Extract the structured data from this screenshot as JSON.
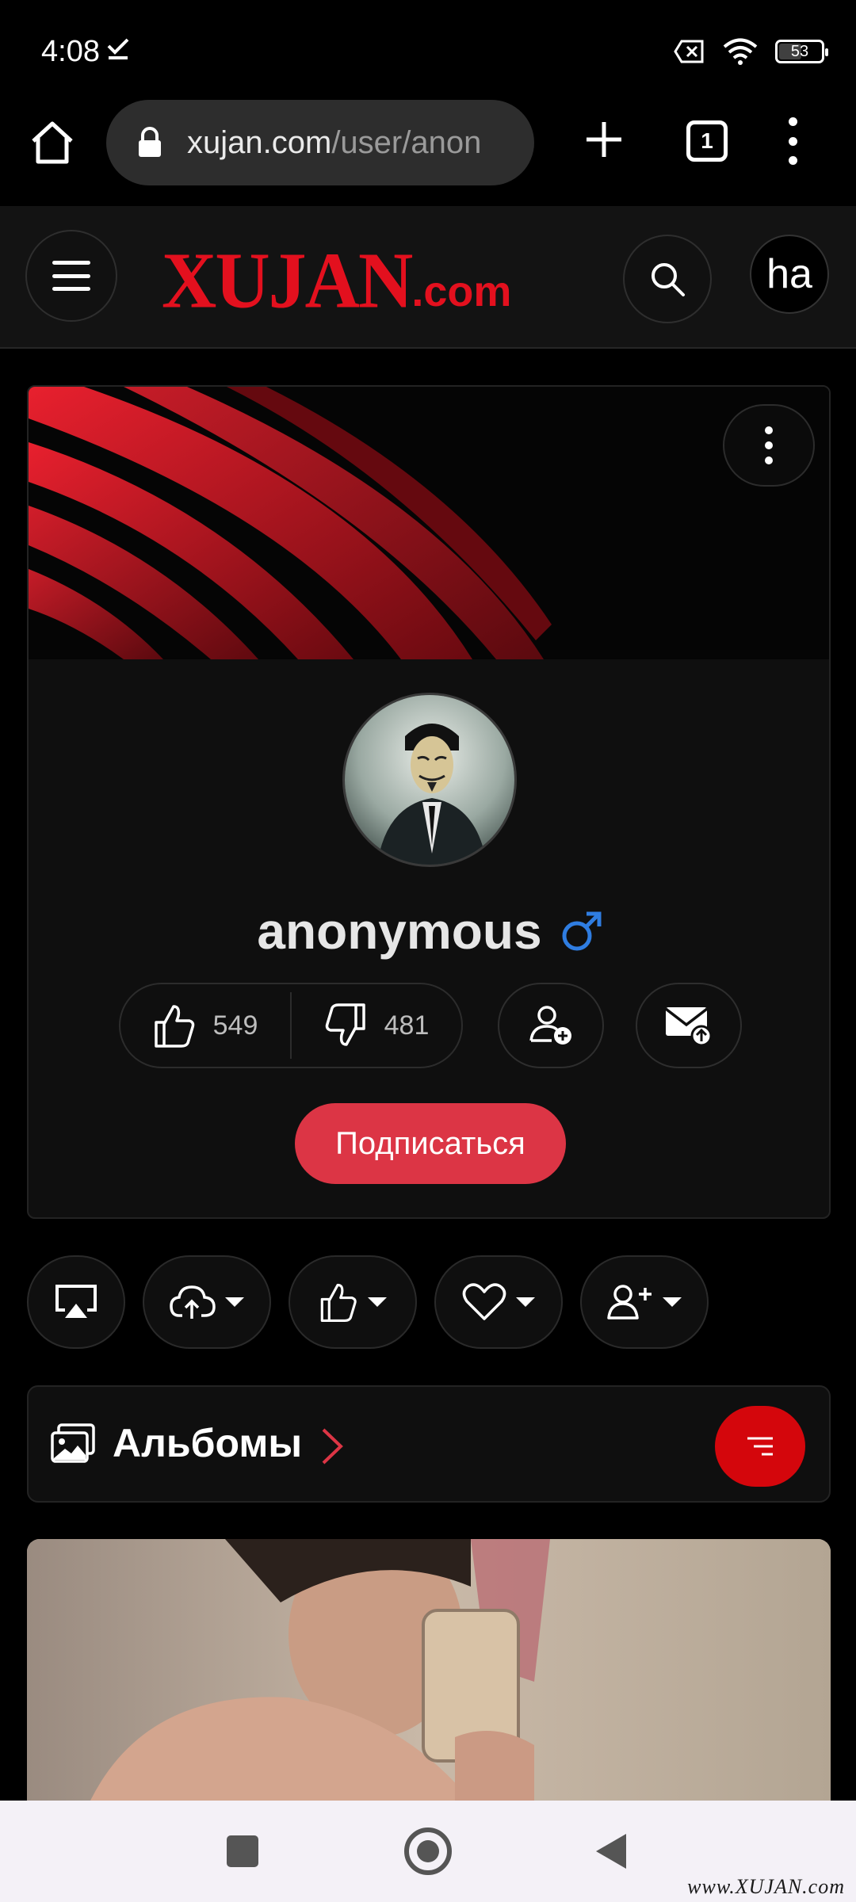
{
  "status_bar": {
    "time": "4:08",
    "battery": "53",
    "battery_level_percent": 53,
    "icons": [
      "check-download-icon",
      "no-sim-icon",
      "wifi-icon",
      "battery-icon"
    ]
  },
  "browser": {
    "url_host": "xujan.com",
    "url_path": "/user/anon",
    "tab_count": "1",
    "icons": [
      "home-icon",
      "lock-icon",
      "new-tab-plus-icon",
      "tabs-icon",
      "overflow-menu-icon"
    ]
  },
  "site_header": {
    "logo_main": "XUJAN",
    "logo_suffix": ".com",
    "avatar_label": "ha",
    "brand_color": "#e3101e"
  },
  "profile": {
    "username": "anonymous",
    "gender_symbol": "♂",
    "likes": "549",
    "dislikes": "481",
    "subscribe_label": "Подписаться",
    "accent_color": "#dc3545"
  },
  "toolbar": {
    "items": [
      {
        "name": "airplay-icon",
        "has_dropdown": false
      },
      {
        "name": "cloud-upload-icon",
        "has_dropdown": true
      },
      {
        "name": "thumbs-up-icon",
        "has_dropdown": true
      },
      {
        "name": "heart-icon",
        "has_dropdown": true
      },
      {
        "name": "user-plus-icon",
        "has_dropdown": true
      }
    ]
  },
  "albums": {
    "title": "Альбомы",
    "filter_color": "#d4060c"
  },
  "footer": {
    "watermark": "www.XUJAN.com"
  }
}
